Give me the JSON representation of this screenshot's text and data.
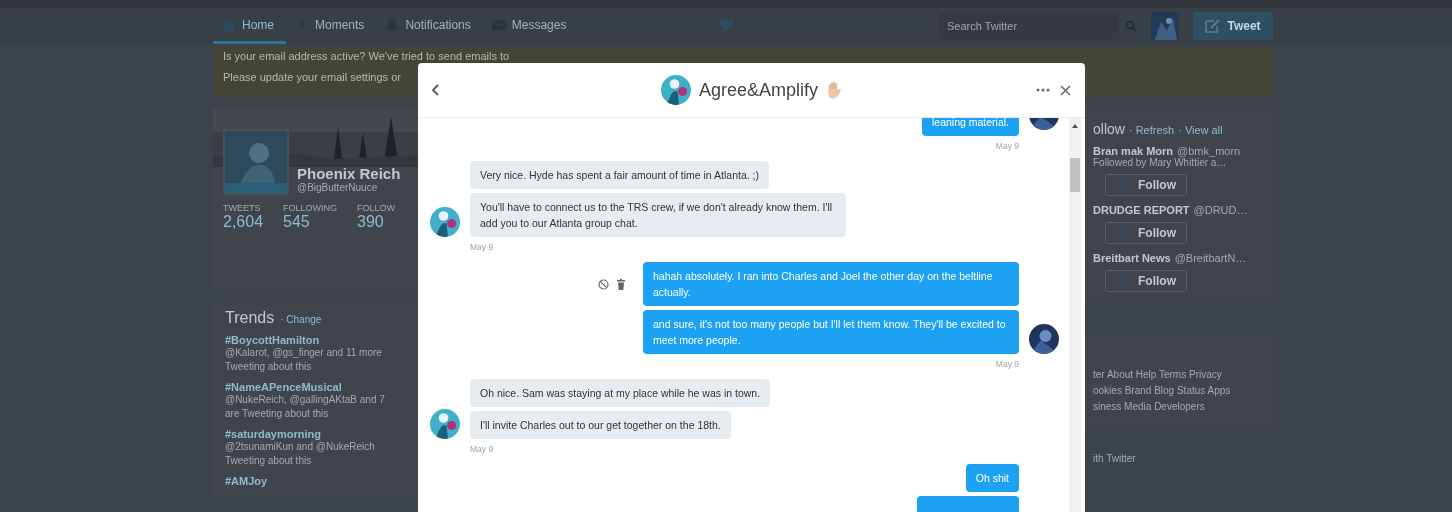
{
  "nav": {
    "tabs": [
      {
        "label": "Home",
        "kind": "home",
        "selected": true
      },
      {
        "label": "Moments",
        "kind": "moments",
        "selected": false
      },
      {
        "label": "Notifications",
        "kind": "notifications",
        "selected": false
      },
      {
        "label": "Messages",
        "kind": "messages",
        "selected": false
      }
    ],
    "search": {
      "placeholder": "Search Twitter"
    },
    "tweet_button": "Tweet"
  },
  "email_banner": {
    "lines": [
      "Is your email address active? We've tried to send emails to",
      "Please update your email settings or"
    ]
  },
  "profile": {
    "name": "Phoenix Reich",
    "handle": "@BigButterNuuce",
    "stats": [
      {
        "label": "TWEETS",
        "value": "2,604"
      },
      {
        "label": "FOLLOWING",
        "value": "545"
      },
      {
        "label": "FOLLOW",
        "value": "390"
      }
    ]
  },
  "trends": {
    "title": "Trends",
    "change": "· Change",
    "items": [
      {
        "tag": "#BoycottHamilton",
        "lines": [
          "@Kalarot, @gs_finger and 11 more",
          "Tweeting about this"
        ]
      },
      {
        "tag": "#NameAPenceMusical",
        "lines": [
          "@NukeReich, @gallingAKtaB and 7",
          "are Tweeting about this"
        ]
      },
      {
        "tag": "#saturdaymorning",
        "lines": [
          "@2tsunamiKun and @NukeReich",
          "Tweeting about this"
        ]
      },
      {
        "tag": "#AMJoy"
      }
    ]
  },
  "who_to_follow": {
    "title": "ollow",
    "links": [
      "· Refresh",
      "· View all"
    ],
    "accounts": [
      {
        "name": "Bran mak Morn",
        "handle": "@bmk_morn",
        "note": "Followed by Mary Whittier a…",
        "follow": "Follow"
      },
      {
        "name": "DRUDGE REPORT",
        "handle": "@DRUD…",
        "follow": "Follow"
      },
      {
        "name": "Breitbart News",
        "handle": "@BreitbartN…",
        "follow": "Follow"
      }
    ]
  },
  "footer": {
    "lines": [
      "ter  About  Help  Terms  Privacy",
      "ookies  Brand  Blog  Status  Apps",
      "siness  Media  Developers"
    ],
    "advertise": "ith Twitter"
  },
  "dialog": {
    "title": "Agree&Amplify",
    "groups": [
      {
        "outgoing": true,
        "messages": [
          {
            "kind": "text",
            "text": "leaning material."
          }
        ],
        "date": "May 9"
      },
      {
        "outgoing": false,
        "messages": [
          {
            "kind": "text",
            "text": "Very nice. Hyde has spent a fair amount of time in Atlanta. ;)"
          },
          {
            "kind": "text",
            "text": "You'll have to connect us to the TRS crew, if we don't already know them. I'll add you to our Atlanta group chat."
          }
        ],
        "date": "May 9"
      },
      {
        "outgoing": true,
        "actions": true,
        "messages": [
          {
            "kind": "text",
            "text": "hahah absolutely. I ran into Charles and Joel the other day on the beltline actually."
          },
          {
            "kind": "text",
            "text": "and sure, it's not too many people but I'll let them know. They'll be excited to meet more people."
          }
        ],
        "date": "May 9"
      },
      {
        "outgoing": false,
        "messages": [
          {
            "kind": "text",
            "text": "Oh nice. Sam was staying at my place while he was in town."
          },
          {
            "kind": "text",
            "text": "I'll invite Charles out to our get together on the 18th."
          }
        ],
        "date": "May 9"
      },
      {
        "outgoing": true,
        "messages": [
          {
            "kind": "text",
            "text": "Oh shit"
          },
          {
            "kind": "clipped"
          }
        ]
      }
    ]
  }
}
